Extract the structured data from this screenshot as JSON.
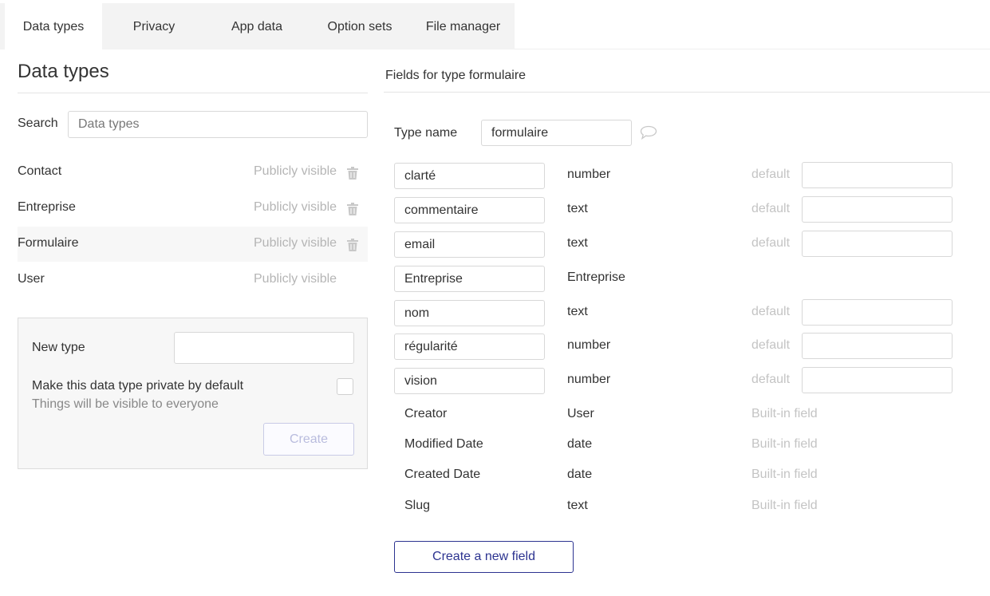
{
  "tabs": [
    {
      "label": "Data types",
      "active": true
    },
    {
      "label": "Privacy",
      "active": false
    },
    {
      "label": "App data",
      "active": false
    },
    {
      "label": "Option sets",
      "active": false
    },
    {
      "label": "File manager",
      "active": false
    }
  ],
  "left": {
    "title": "Data types",
    "search_label": "Search",
    "search_placeholder": "Data types",
    "types": [
      {
        "name": "Contact",
        "visibility": "Publicly visible",
        "deletable": true,
        "selected": false
      },
      {
        "name": "Entreprise",
        "visibility": "Publicly visible",
        "deletable": true,
        "selected": false
      },
      {
        "name": "Formulaire",
        "visibility": "Publicly visible",
        "deletable": true,
        "selected": true
      },
      {
        "name": "User",
        "visibility": "Publicly visible",
        "deletable": false,
        "selected": false
      }
    ],
    "new_type": {
      "label": "New type",
      "private_label": "Make this data type private by default",
      "private_sub": "Things will be visible to everyone",
      "create_label": "Create"
    }
  },
  "right": {
    "title": "Fields for type formulaire",
    "type_name_label": "Type name",
    "type_name_value": "formulaire",
    "fields": [
      {
        "name": "clarté",
        "type": "number",
        "default_label": "default"
      },
      {
        "name": "commentaire",
        "type": "text",
        "default_label": "default"
      },
      {
        "name": "email",
        "type": "text",
        "default_label": "default"
      },
      {
        "name": "Entreprise",
        "type": "Entreprise",
        "default_label": ""
      },
      {
        "name": "nom",
        "type": "text",
        "default_label": "default"
      },
      {
        "name": "régularité",
        "type": "number",
        "default_label": "default"
      },
      {
        "name": "vision",
        "type": "number",
        "default_label": "default"
      }
    ],
    "builtin_fields": [
      {
        "name": "Creator",
        "type": "User",
        "label": "Built-in field"
      },
      {
        "name": "Modified Date",
        "type": "date",
        "label": "Built-in field"
      },
      {
        "name": "Created Date",
        "type": "date",
        "label": "Built-in field"
      },
      {
        "name": "Slug",
        "type": "text",
        "label": "Built-in field"
      }
    ],
    "new_field_label": "Create a new field"
  },
  "icons": {
    "trash": "trash-icon",
    "comment": "comment-icon"
  },
  "colors": {
    "accent": "#2c3390",
    "muted": "#b5b5b5"
  }
}
